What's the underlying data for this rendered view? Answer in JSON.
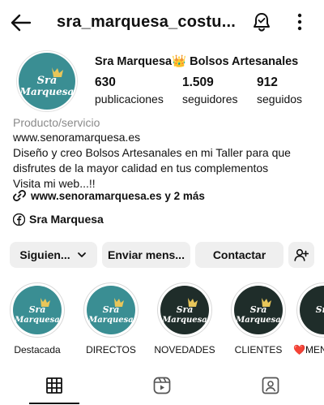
{
  "header": {
    "username": "sra_marquesa_costu...",
    "back_icon": "arrow-left-icon",
    "bell_icon": "bell-icon",
    "more_icon": "more-vertical-icon"
  },
  "profile": {
    "display_name": "Sra Marquesa👑 Bolsos Artesanales",
    "avatar_logo_text_line1": "Sra",
    "avatar_logo_text_line2": "Marquesa",
    "avatar_color": "#3a8e93",
    "stats": [
      {
        "value": "630",
        "label": "publicaciones"
      },
      {
        "value": "1.509",
        "label": "seguidores"
      },
      {
        "value": "912",
        "label": "seguidos"
      }
    ]
  },
  "bio": {
    "category": "Producto/servicio",
    "lines": [
      "www.senoramarquesa.es",
      "Diseño y creo Bolsos Artesanales en mi Taller para que",
      "disfrutes de la mayor calidad en tus complementos",
      "Visita mi web...!!"
    ],
    "links_text": "www.senoramarquesa.es y 2 más",
    "facebook_name": "Sra Marquesa"
  },
  "actions": {
    "following_label": "Siguien...",
    "message_label": "Enviar mens...",
    "contact_label": "Contactar",
    "add_user_icon": "add-user-icon"
  },
  "highlights": [
    {
      "label": "Destacada",
      "style": "teal"
    },
    {
      "label": "DIRECTOS",
      "style": "teal"
    },
    {
      "label": "NOVEDADES",
      "style": "dark"
    },
    {
      "label": "CLIENTES",
      "style": "dark"
    },
    {
      "label": "❤️MEN",
      "style": "dark"
    }
  ],
  "tabs": [
    {
      "name": "grid",
      "icon": "grid-icon",
      "active": true
    },
    {
      "name": "reels",
      "icon": "reels-icon",
      "active": false
    },
    {
      "name": "tagged",
      "icon": "tagged-icon",
      "active": false
    }
  ]
}
